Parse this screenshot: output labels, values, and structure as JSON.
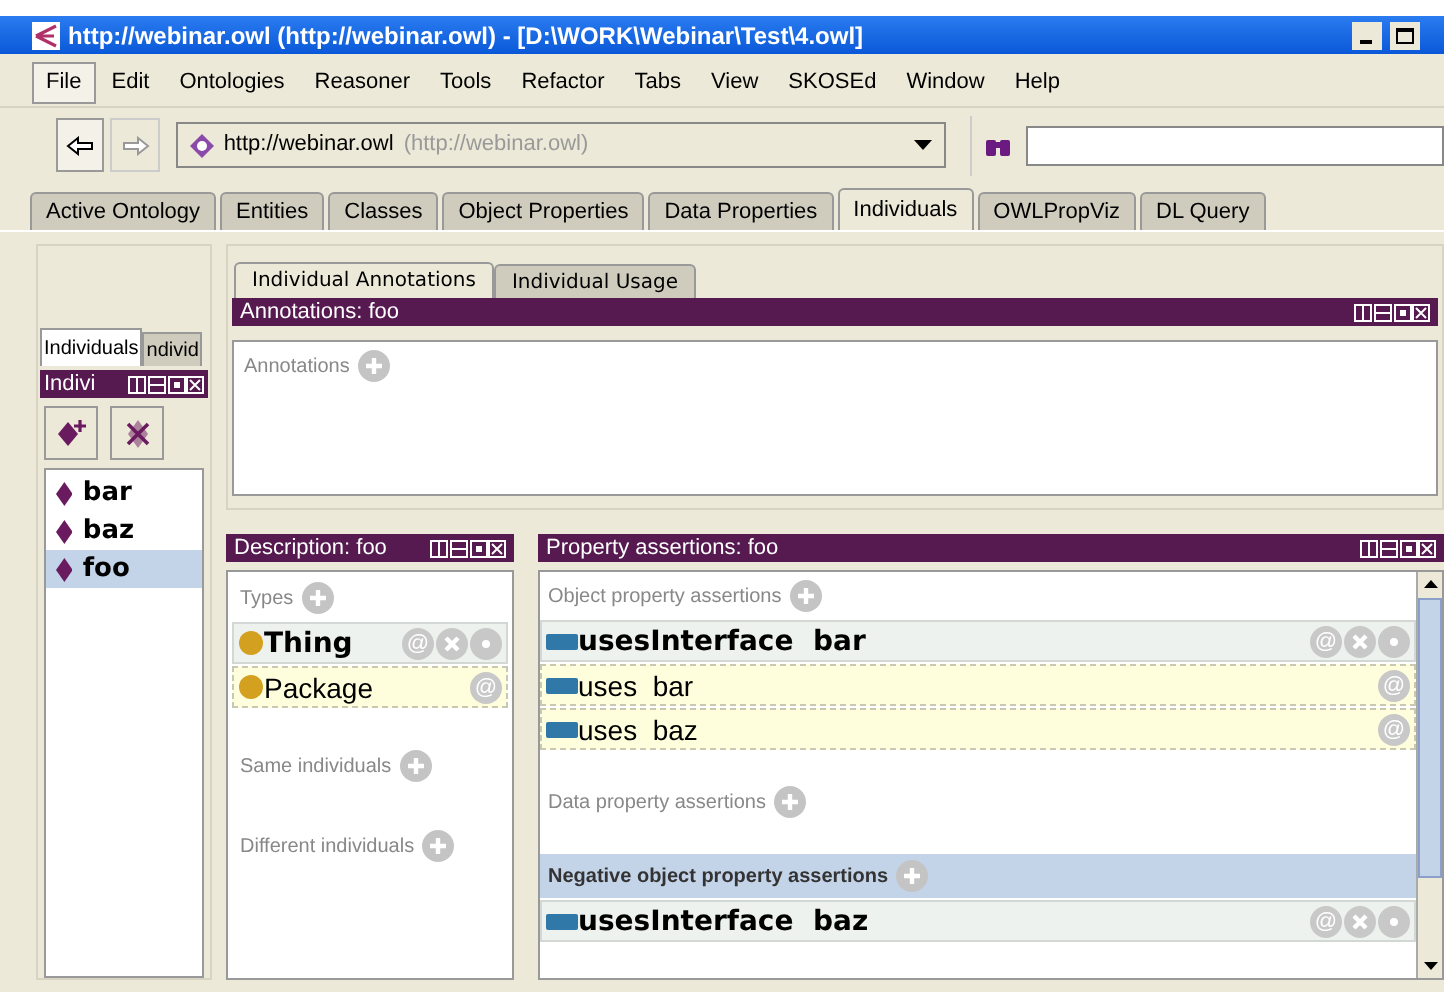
{
  "window": {
    "title": "http://webinar.owl (http://webinar.owl) - [D:\\WORK\\Webinar\\Test\\4.owl]"
  },
  "menu": [
    {
      "label": "File",
      "selected": true
    },
    {
      "label": "Edit",
      "selected": false
    },
    {
      "label": "Ontologies",
      "selected": false
    },
    {
      "label": "Reasoner",
      "selected": false
    },
    {
      "label": "Tools",
      "selected": false
    },
    {
      "label": "Refactor",
      "selected": false
    },
    {
      "label": "Tabs",
      "selected": false
    },
    {
      "label": "View",
      "selected": false
    },
    {
      "label": "SKOSEd",
      "selected": false
    },
    {
      "label": "Window",
      "selected": false
    },
    {
      "label": "Help",
      "selected": false
    }
  ],
  "row_button_glyph": "@",
  "toolbar": {
    "address": "http://webinar.owl",
    "address_detail": "(http://webinar.owl)"
  },
  "tabs": [
    {
      "label": "Active Ontology",
      "selected": false
    },
    {
      "label": "Entities",
      "selected": false
    },
    {
      "label": "Classes",
      "selected": false
    },
    {
      "label": "Object Properties",
      "selected": false
    },
    {
      "label": "Data Properties",
      "selected": false
    },
    {
      "label": "Individuals",
      "selected": true
    },
    {
      "label": "OWLPropViz",
      "selected": false
    },
    {
      "label": "DL Query",
      "selected": false
    }
  ],
  "left_panel": {
    "tabs": [
      {
        "label": "Individuals",
        "selected": true
      },
      {
        "label": "ndivid",
        "selected": false
      }
    ],
    "title": "Indivi",
    "items": [
      {
        "label": "bar",
        "selected": false
      },
      {
        "label": "baz",
        "selected": false
      },
      {
        "label": "foo",
        "selected": true
      }
    ]
  },
  "detail_tabs": [
    {
      "label": "Individual Annotations",
      "selected": true
    },
    {
      "label": "Individual Usage",
      "selected": false
    }
  ],
  "annotations": {
    "title": "Annotations: foo",
    "section": "Annotations"
  },
  "description": {
    "title": "Description: foo",
    "sections": [
      {
        "label": "Types",
        "selected": false,
        "items": [
          {
            "label": "Thing",
            "inferred": false
          },
          {
            "label": "Package",
            "inferred": true
          }
        ]
      },
      {
        "label": "Same individuals",
        "selected": false
      },
      {
        "label": "Different individuals",
        "selected": false
      }
    ]
  },
  "property_assertions": {
    "title": "Property assertions: foo",
    "sections": [
      {
        "label": "Object property assertions",
        "selected": false,
        "items": [
          {
            "label": "usesInterface  bar",
            "inferred": false
          },
          {
            "label": "uses  bar",
            "inferred": true
          },
          {
            "label": "uses  baz",
            "inferred": true
          }
        ]
      },
      {
        "label": "Data property assertions",
        "selected": false
      },
      {
        "label": "Negative object property assertions",
        "selected": true,
        "items": [
          {
            "label": "usesInterface  baz",
            "inferred": false
          }
        ]
      }
    ]
  }
}
